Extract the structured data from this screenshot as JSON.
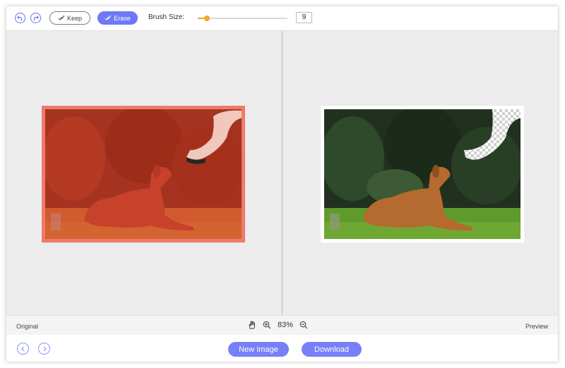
{
  "toolbar": {
    "undo_icon": "undo-icon",
    "redo_icon": "redo-icon",
    "keep_label": "Keep",
    "erase_label": "Erase",
    "brush_size_label": "Brush Size:",
    "brush_size_value": "9",
    "brush_size_fraction": 0.1,
    "slider_color": "#f5a623"
  },
  "panels": {
    "left_overlay_color": "#e25a44",
    "right_background": "transparent-checkerboard"
  },
  "status_bar": {
    "left_label": "Original",
    "zoom_value": "83%",
    "right_label": "Preview"
  },
  "footer": {
    "new_image_label": "New Image",
    "download_label": "Download",
    "accent_color": "#7780f6"
  }
}
